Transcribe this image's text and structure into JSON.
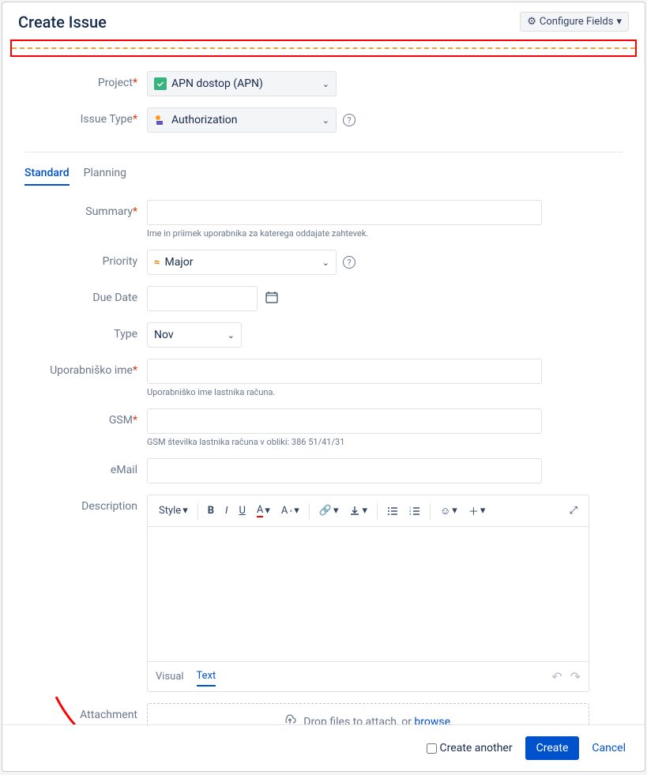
{
  "header": {
    "title": "Create Issue",
    "configure": "Configure Fields"
  },
  "fields": {
    "project": {
      "label": "Project",
      "value": "APN dostop (APN)"
    },
    "issueType": {
      "label": "Issue Type",
      "value": "Authorization"
    },
    "summary": {
      "label": "Summary",
      "help": "Ime in priimek uporabnika za katerega oddajate zahtevek."
    },
    "priority": {
      "label": "Priority",
      "value": "Major"
    },
    "dueDate": {
      "label": "Due Date"
    },
    "type": {
      "label": "Type",
      "value": "Nov"
    },
    "username": {
      "label": "Uporabniško ime",
      "help": "Uporabniško ime lastnika računa."
    },
    "gsm": {
      "label": "GSM",
      "help": "GSM številka lastnika računa v obliki: 386 51/41/31"
    },
    "email": {
      "label": "eMail"
    },
    "description": {
      "label": "Description"
    },
    "attachment": {
      "label": "Attachment",
      "dropText": "Drop files to attach, or ",
      "browse": "browse"
    }
  },
  "tabs": {
    "standard": "Standard",
    "planning": "Planning"
  },
  "editor": {
    "style": "Style",
    "visual": "Visual",
    "text": "Text"
  },
  "footer": {
    "createAnother": "Create another",
    "create": "Create",
    "cancel": "Cancel"
  }
}
